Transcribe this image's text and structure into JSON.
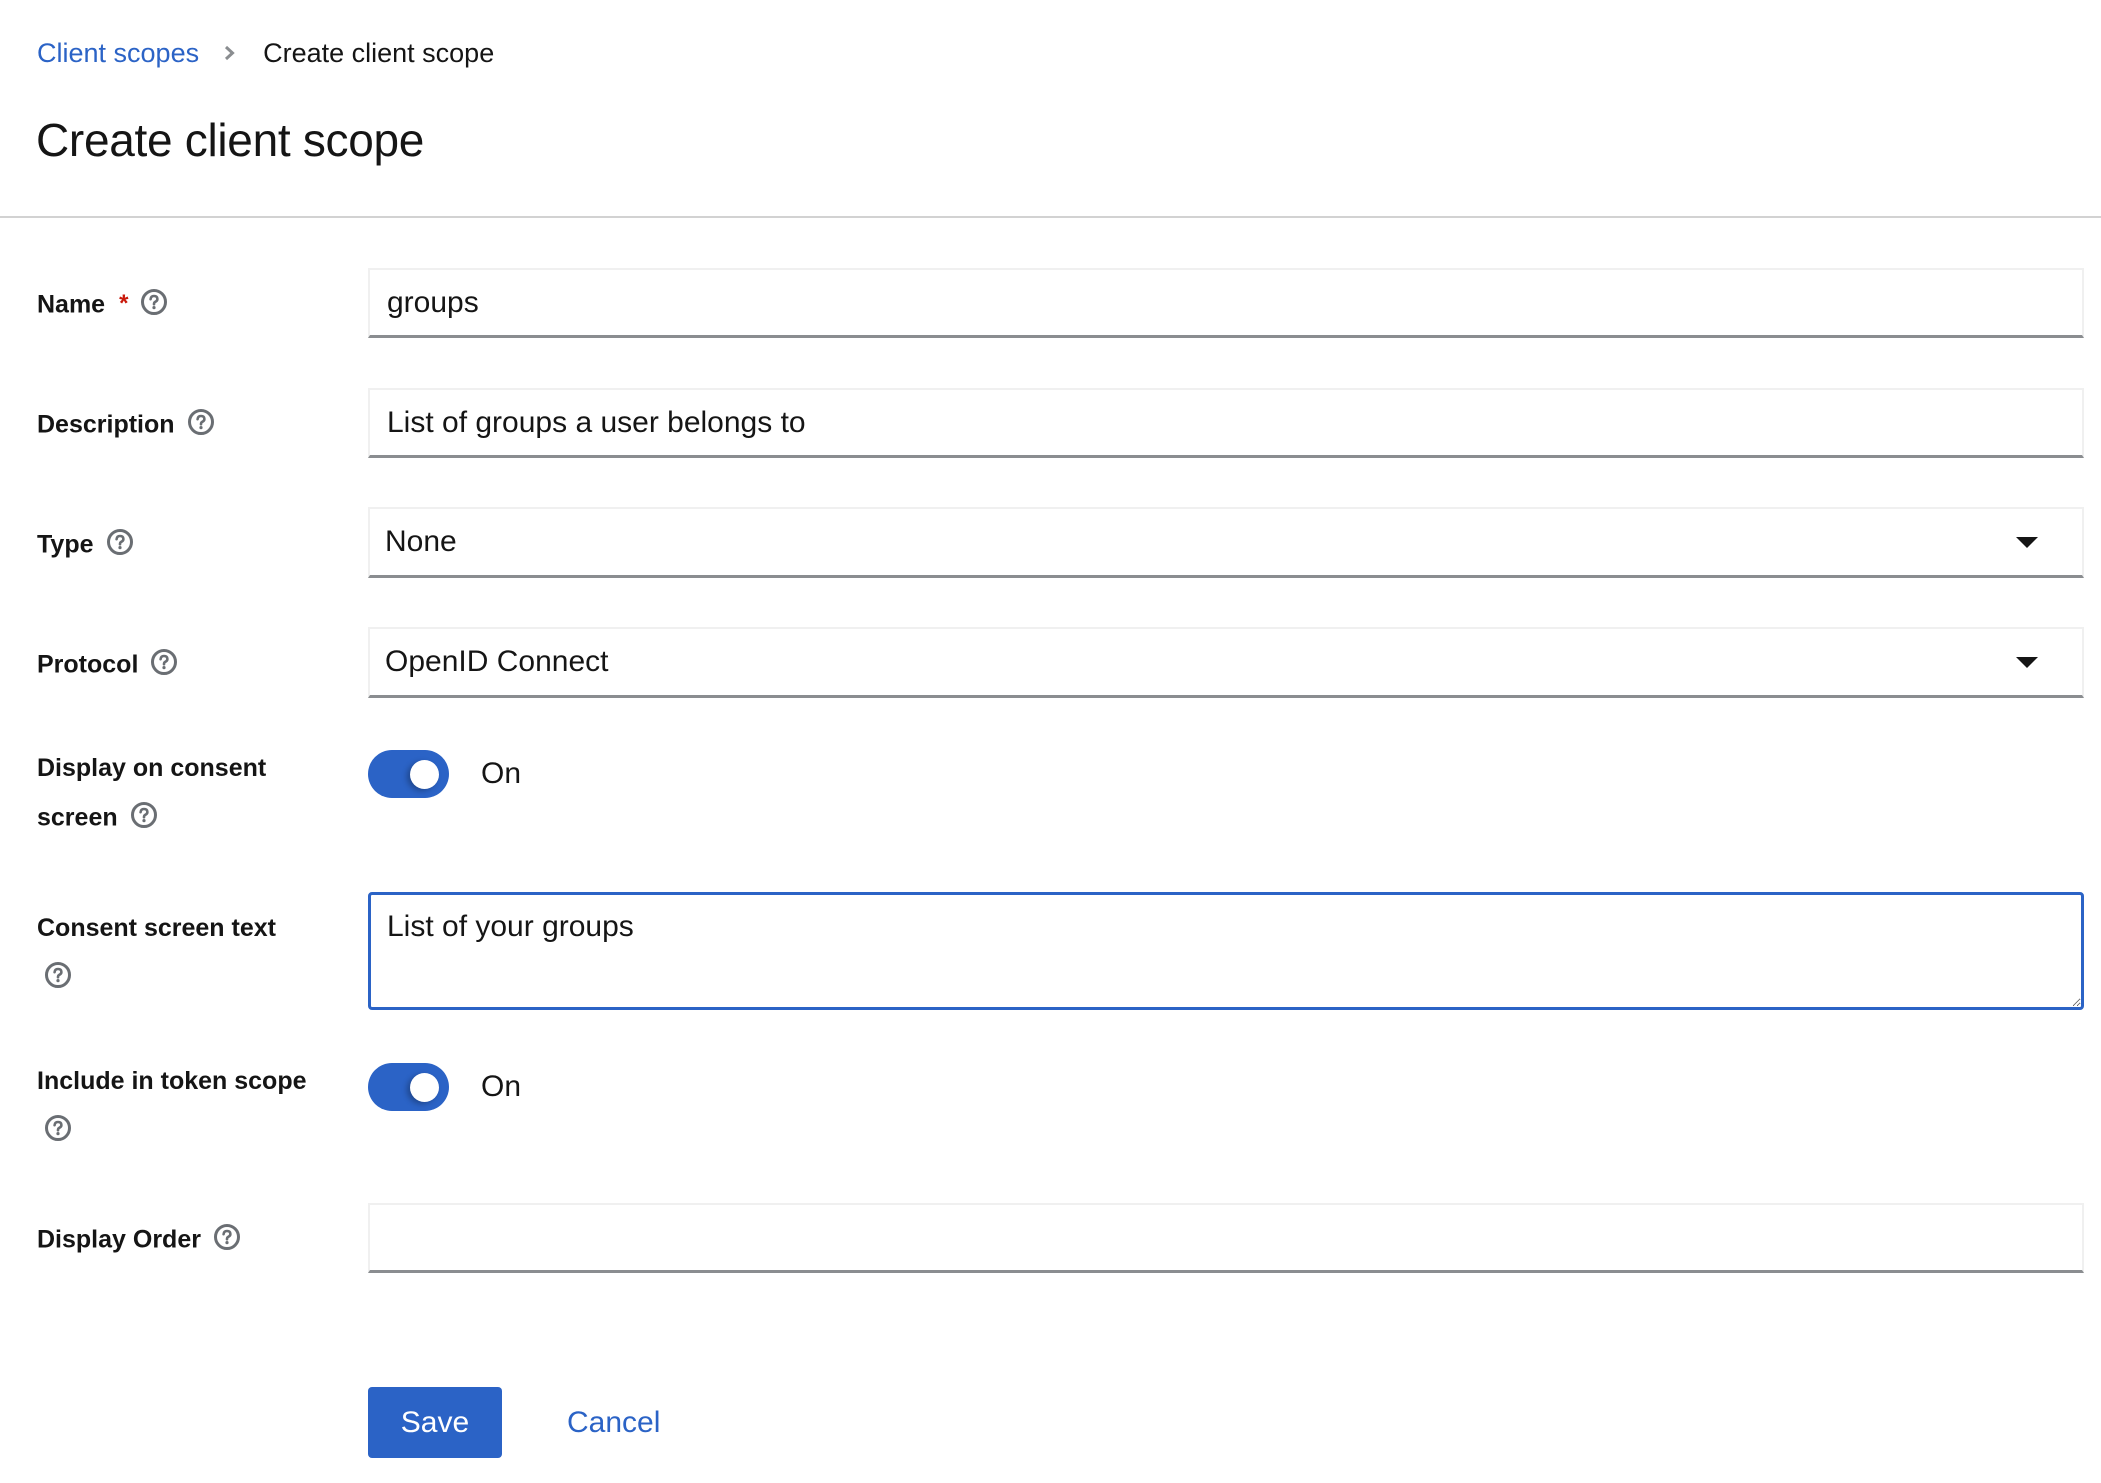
{
  "breadcrumb": {
    "parent": "Client scopes",
    "current": "Create client scope"
  },
  "page": {
    "title": "Create client scope"
  },
  "form": {
    "name": {
      "label": "Name",
      "required_mark": "*",
      "value": "groups"
    },
    "description": {
      "label": "Description",
      "value": "List of groups a user belongs to"
    },
    "type": {
      "label": "Type",
      "selected": "None"
    },
    "protocol": {
      "label": "Protocol",
      "selected": "OpenID Connect"
    },
    "display_on_consent": {
      "label_line1": "Display on consent",
      "label_line2": "screen",
      "state": "On",
      "checked": true
    },
    "consent_text": {
      "label": "Consent screen text",
      "value": "List of your groups"
    },
    "include_in_token": {
      "label": "Include in token scope",
      "state": "On",
      "checked": true
    },
    "display_order": {
      "label": "Display Order",
      "value": ""
    }
  },
  "actions": {
    "save": "Save",
    "cancel": "Cancel"
  },
  "colors": {
    "primary": "#2b63c6",
    "required": "#c9190b",
    "text": "#151515",
    "icon_gray": "#6a6e73"
  }
}
